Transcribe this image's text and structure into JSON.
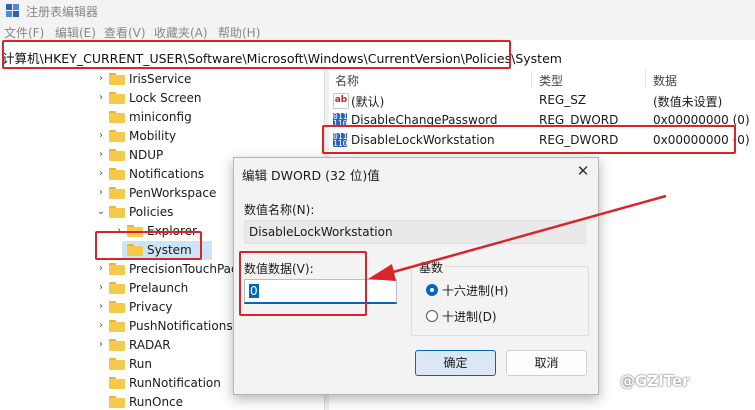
{
  "window": {
    "title": "注册表编辑器"
  },
  "menu": [
    "文件(F)",
    "编辑(E)",
    "查看(V)",
    "收藏夹(A)",
    "帮助(H)"
  ],
  "address": {
    "path": "计算机\\HKEY_CURRENT_USER\\Software\\Microsoft\\Windows\\CurrentVersion\\Policies\\System"
  },
  "tree": [
    {
      "label": "IrisService",
      "expandable": true
    },
    {
      "label": "Lock Screen",
      "expandable": true
    },
    {
      "label": "miniconfig",
      "expandable": false
    },
    {
      "label": "Mobility",
      "expandable": true
    },
    {
      "label": "NDUP",
      "expandable": true
    },
    {
      "label": "Notifications",
      "expandable": true
    },
    {
      "label": "PenWorkspace",
      "expandable": true
    },
    {
      "label": "Policies",
      "expanded": true
    },
    {
      "label": "Explorer",
      "expandable": true
    },
    {
      "label": "System",
      "selected": true
    },
    {
      "label": "PrecisionTouchPad",
      "expandable": true
    },
    {
      "label": "Prelaunch",
      "expandable": true
    },
    {
      "label": "Privacy",
      "expandable": true
    },
    {
      "label": "PushNotifications",
      "expandable": true
    },
    {
      "label": "RADAR",
      "expandable": true
    },
    {
      "label": "Run",
      "expandable": false
    },
    {
      "label": "RunNotification",
      "expandable": false
    },
    {
      "label": "RunOnce",
      "expandable": false
    }
  ],
  "list": {
    "headers": {
      "name": "名称",
      "type": "类型",
      "data": "数据"
    },
    "rows": [
      {
        "icon": "string-value-icon",
        "name": "(默认)",
        "type": "REG_SZ",
        "data": "(数值未设置)"
      },
      {
        "icon": "binary-value-icon",
        "name": "DisableChangePassword",
        "type": "REG_DWORD",
        "data": "0x00000000 (0)"
      },
      {
        "icon": "binary-value-icon",
        "name": "DisableLockWorkstation",
        "type": "REG_DWORD",
        "data": "0x00000000 (0)"
      }
    ]
  },
  "dialog": {
    "title": "编辑 DWORD (32 位)值",
    "close": "✕",
    "name_label": "数值名称(N):",
    "name_value": "DisableLockWorkstation",
    "data_label": "数值数据(V):",
    "data_value": "0",
    "base_label": "基数",
    "hex_label": "十六进制(H)",
    "dec_label": "十进制(D)",
    "hex_selected": true,
    "ok": "确定",
    "cancel": "取消"
  },
  "watermark": "@GZITer",
  "colors": {
    "highlight": "#d9242b",
    "accent": "#0067c0",
    "selection": "#cce4f7"
  }
}
